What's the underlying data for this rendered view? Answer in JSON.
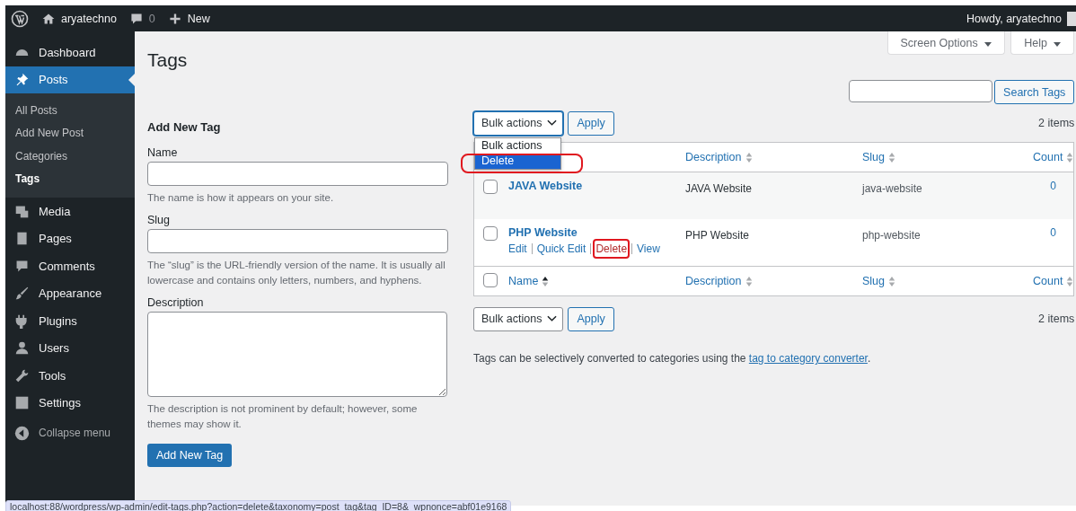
{
  "admin_bar": {
    "site": "aryatechno",
    "comments": "0",
    "new": "New",
    "greeting": "Howdy, aryatechno"
  },
  "sidebar": {
    "items": [
      {
        "label": "Dashboard",
        "selected": false
      },
      {
        "label": "Posts",
        "selected": true,
        "children": [
          {
            "label": "All Posts",
            "selected": false
          },
          {
            "label": "Add New Post",
            "selected": false
          },
          {
            "label": "Categories",
            "selected": false
          },
          {
            "label": "Tags",
            "selected": true
          }
        ]
      },
      {
        "label": "Media",
        "selected": false
      },
      {
        "label": "Pages",
        "selected": false
      },
      {
        "label": "Comments",
        "selected": false
      },
      {
        "label": "Appearance",
        "selected": false
      },
      {
        "label": "Plugins",
        "selected": false
      },
      {
        "label": "Users",
        "selected": false
      },
      {
        "label": "Tools",
        "selected": false
      },
      {
        "label": "Settings",
        "selected": false
      }
    ],
    "collapse": "Collapse menu"
  },
  "page": {
    "title": "Tags",
    "screen_options": "Screen Options",
    "help": "Help",
    "search_button": "Search Tags"
  },
  "form": {
    "heading": "Add New Tag",
    "fields": [
      {
        "label": "Name",
        "kind": "input",
        "hint": "The name is how it appears on your site."
      },
      {
        "label": "Slug",
        "kind": "input",
        "hint": "The “slug” is the URL-friendly version of the name. It is usually all lowercase and contains only letters, numbers, and hyphens."
      },
      {
        "label": "Description",
        "kind": "textarea",
        "hint": "The description is not prominent by default; however, some themes may show it."
      }
    ],
    "submit": "Add New Tag"
  },
  "top_actions": {
    "select": "Bulk actions",
    "apply": "Apply",
    "count": "2 items",
    "dropdown": {
      "expanded": true,
      "options": [
        {
          "label": "Bulk actions",
          "selected": false
        },
        {
          "label": "Delete",
          "selected": true
        }
      ]
    }
  },
  "table": {
    "header": [
      {
        "label": "Description",
        "sorted": false
      },
      {
        "label": "Slug",
        "sorted": false
      },
      {
        "label": "Count",
        "sorted": false
      }
    ],
    "rows": [
      {
        "name": "JAVA Website",
        "description": "JAVA Website",
        "slug": "java-website",
        "count": "0",
        "checked": false
      },
      {
        "name": "PHP Website",
        "description": "PHP Website",
        "slug": "php-website",
        "count": "0",
        "checked": false,
        "actions": [
          {
            "label": "Edit",
            "kind": "link"
          },
          {
            "label": "Quick Edit",
            "kind": "link"
          },
          {
            "label": "Delete",
            "kind": "delete"
          },
          {
            "label": "View",
            "kind": "link"
          }
        ]
      }
    ],
    "footer_checked": false,
    "footer": [
      {
        "label": "Name",
        "sorted": true
      },
      {
        "label": "Description",
        "sorted": false
      },
      {
        "label": "Slug",
        "sorted": false
      },
      {
        "label": "Count",
        "sorted": false
      }
    ]
  },
  "bottom_actions": {
    "select": "Bulk actions",
    "apply": "Apply",
    "count": "2 items"
  },
  "note": {
    "text": "Tags can be selectively converted to categories using the ",
    "link": "tag to category converter",
    "after": "."
  },
  "status_url": "localhost:88/wordpress/wp-admin/edit-tags.php?action=delete&taxonomy=post_tag&tag_ID=8&_wpnonce=abf01e9168"
}
